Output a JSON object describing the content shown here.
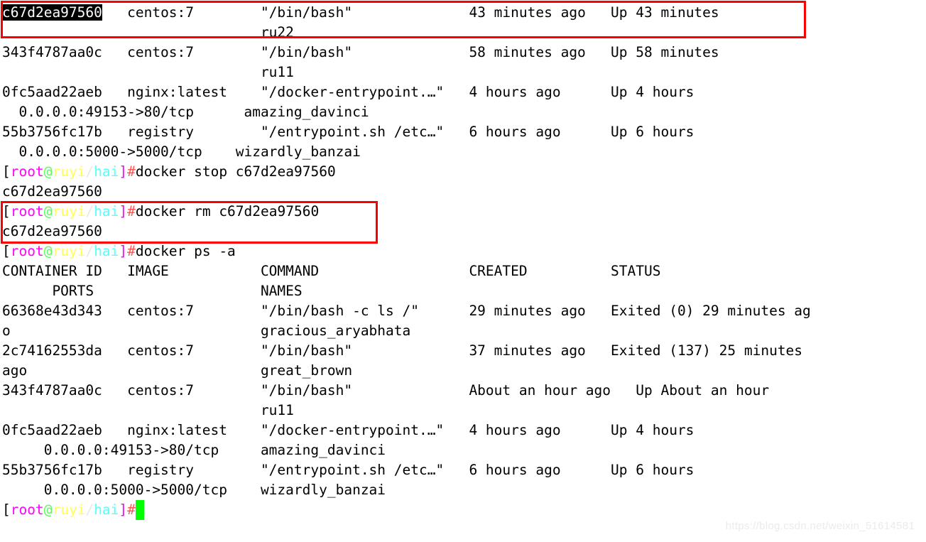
{
  "terminal": {
    "prompt": {
      "open_bracket": "[",
      "user": "root",
      "at": "@",
      "host": "ruyi",
      "slash": "/",
      "path": "hai",
      "close_bracket": "]",
      "hash": "#"
    },
    "lines": [
      {
        "id": "ps-row1-main",
        "text": "c67d2ea97560   centos:7        \"/bin/bash\"              43 minutes ago   Up 43 minutes"
      },
      {
        "id": "ps-row1-names",
        "text": "                               ru22"
      },
      {
        "id": "ps-row2-main",
        "text": "343f4787aa0c   centos:7        \"/bin/bash\"              58 minutes ago   Up 58 minutes"
      },
      {
        "id": "ps-row2-names",
        "text": "                               ru11"
      },
      {
        "id": "ps-row3-main",
        "text": "0fc5aad22aeb   nginx:latest    \"/docker-entrypoint.…\"   4 hours ago      Up 4 hours"
      },
      {
        "id": "ps-row3-ports",
        "text": "  0.0.0.0:49153->80/tcp      amazing_davinci"
      },
      {
        "id": "ps-row4-main",
        "text": "55b3756fc17b   registry        \"/entrypoint.sh /etc…\"   6 hours ago      Up 6 hours"
      },
      {
        "id": "ps-row4-ports",
        "text": "  0.0.0.0:5000->5000/tcp    wizardly_banzai"
      },
      {
        "id": "cmd-stop",
        "text": "docker stop c67d2ea97560"
      },
      {
        "id": "out-stop",
        "text": "c67d2ea97560"
      },
      {
        "id": "cmd-rm",
        "text": "docker rm c67d2ea97560"
      },
      {
        "id": "out-rm",
        "text": "c67d2ea97560"
      },
      {
        "id": "cmd-ps-a",
        "text": "docker ps -a"
      },
      {
        "id": "hdr-main",
        "text": "CONTAINER ID   IMAGE           COMMAND                  CREATED          STATUS"
      },
      {
        "id": "hdr-cont",
        "text": "      PORTS                    NAMES"
      },
      {
        "id": "psa-row1-main",
        "text": "66368e43d343   centos:7        \"/bin/bash -c ls /\"      29 minutes ago   Exited (0) 29 minutes ag"
      },
      {
        "id": "psa-row1-wrap",
        "text": "o                              gracious_aryabhata"
      },
      {
        "id": "psa-row2-main",
        "text": "2c74162553da   centos:7        \"/bin/bash\"              37 minutes ago   Exited (137) 25 minutes "
      },
      {
        "id": "psa-row2-wrap",
        "text": "ago                            great_brown"
      },
      {
        "id": "psa-row3-main",
        "text": "343f4787aa0c   centos:7        \"/bin/bash\"              About an hour ago   Up About an hour"
      },
      {
        "id": "psa-row3-names",
        "text": "                               ru11"
      },
      {
        "id": "psa-row4-main",
        "text": "0fc5aad22aeb   nginx:latest    \"/docker-entrypoint.…\"   4 hours ago      Up 4 hours"
      },
      {
        "id": "psa-row4-ports",
        "text": "     0.0.0.0:49153->80/tcp     amazing_davinci"
      },
      {
        "id": "psa-row5-main",
        "text": "55b3756fc17b   registry        \"/entrypoint.sh /etc…\"   6 hours ago      Up 6 hours"
      },
      {
        "id": "psa-row5-ports",
        "text": "     0.0.0.0:5000->5000/tcp    wizardly_banzai"
      }
    ],
    "selected_text": "c67d2ea97560",
    "watermark": "https://blog.csdn.net/weixin_51614581",
    "colors": {
      "background": "#ffffff",
      "foreground": "#000000",
      "user": "#ff00ff",
      "at": "#55ff55",
      "host": "#ffff55",
      "path": "#55ffff",
      "hash": "#ff5555",
      "cursor": "#00ff00",
      "highlight_box": "#ff0000",
      "selection_bg": "#000000",
      "selection_fg": "#ffffff"
    }
  }
}
